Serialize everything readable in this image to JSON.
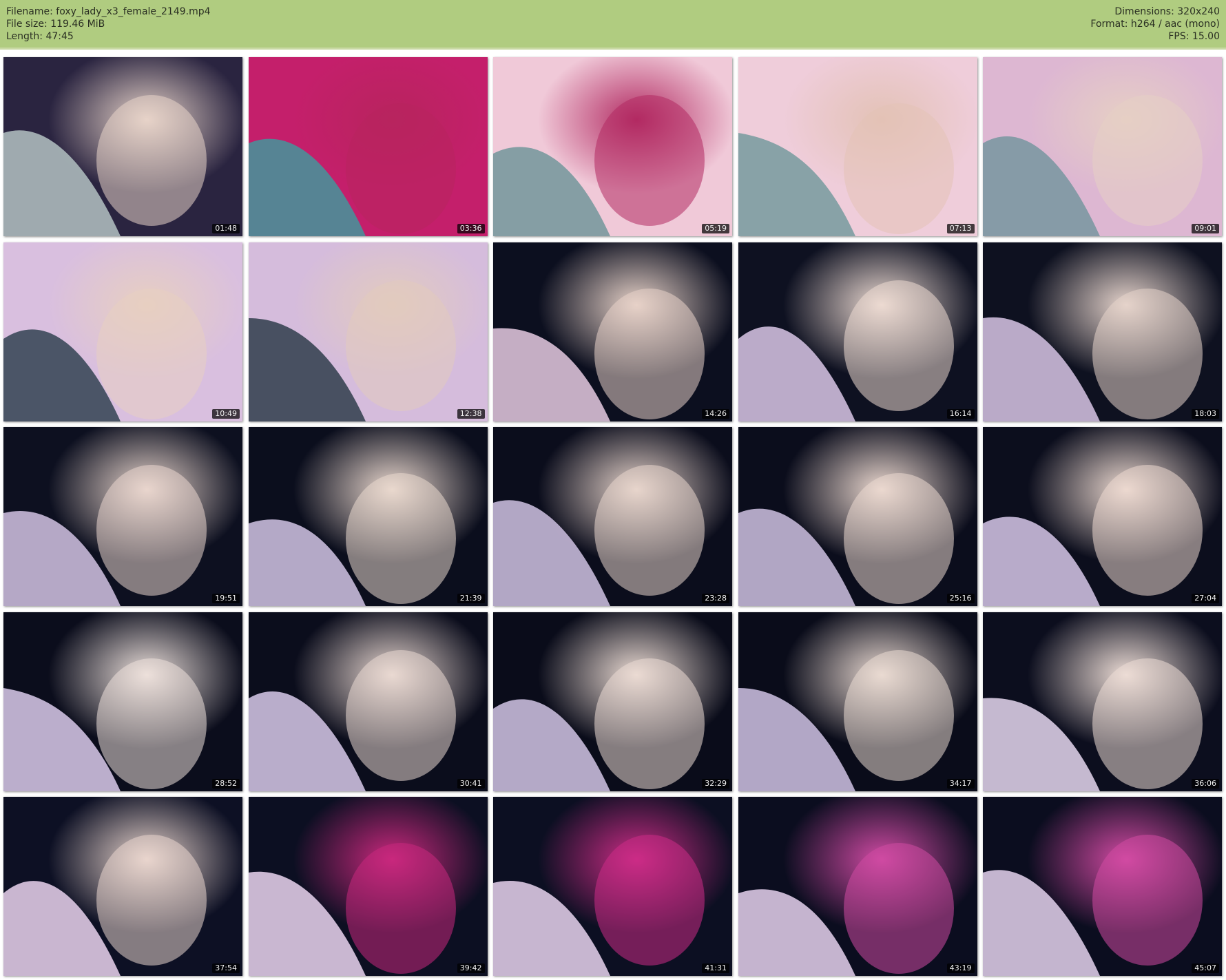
{
  "header": {
    "filename_label": "Filename: foxy_lady_x3_female_2149.mp4",
    "filesize_label": "File size: 119.46 MiB",
    "length_label": "Length: 47:45",
    "dimensions_label": "Dimensions: 320x240",
    "format_label": "Format: h264 / aac (mono)",
    "fps_label": "FPS: 15.00"
  },
  "colors": {
    "header_bg": "#b0cc80",
    "timestamp_bg": "#000000",
    "timestamp_text": "#f2f2f2"
  },
  "thumbnails": [
    {
      "time": "01:48",
      "palette": [
        "#2a2440",
        "#a9b6b9",
        "#e7d3c9"
      ]
    },
    {
      "time": "03:36",
      "palette": [
        "#c41f6b",
        "#4c8d98",
        "#b8245e"
      ]
    },
    {
      "time": "05:19",
      "palette": [
        "#f0c9d8",
        "#7c9aa0",
        "#b22a62"
      ]
    },
    {
      "time": "07:13",
      "palette": [
        "#efcdda",
        "#7f9ea3",
        "#e3c2b6"
      ]
    },
    {
      "time": "09:01",
      "palette": [
        "#ddb7d2",
        "#7e98a3",
        "#e6cfc4"
      ]
    },
    {
      "time": "10:49",
      "palette": [
        "#d9bfdf",
        "#3f4c5c",
        "#e7cfc1"
      ]
    },
    {
      "time": "12:38",
      "palette": [
        "#d5bcdc",
        "#3c4656",
        "#e2cbbe"
      ]
    },
    {
      "time": "14:26",
      "palette": [
        "#0c0f1f",
        "#d6bcd3",
        "#e7d2c8"
      ]
    },
    {
      "time": "16:14",
      "palette": [
        "#0e1121",
        "#cab9d8",
        "#ecdad2"
      ]
    },
    {
      "time": "18:03",
      "palette": [
        "#0e1120",
        "#c9b7d7",
        "#e5d3cb"
      ]
    },
    {
      "time": "19:51",
      "palette": [
        "#0d1020",
        "#c3b5d5",
        "#e9d6cd"
      ]
    },
    {
      "time": "21:39",
      "palette": [
        "#0b0e1d",
        "#c3b6d6",
        "#ead8ce"
      ]
    },
    {
      "time": "23:28",
      "palette": [
        "#0b0d1c",
        "#c1b4d4",
        "#e8d5cc"
      ]
    },
    {
      "time": "25:16",
      "palette": [
        "#0b0d1c",
        "#c0b3d3",
        "#ebd8cf"
      ]
    },
    {
      "time": "27:04",
      "palette": [
        "#0c0e1d",
        "#c8b9d9",
        "#ecd9d0"
      ]
    },
    {
      "time": "28:52",
      "palette": [
        "#0b0d1c",
        "#cbbcdb",
        "#ece0db"
      ]
    },
    {
      "time": "30:41",
      "palette": [
        "#0b0d1c",
        "#c9bbda",
        "#ead9d2"
      ]
    },
    {
      "time": "32:29",
      "palette": [
        "#0a0c1a",
        "#c3b7d6",
        "#ebdbd3"
      ]
    },
    {
      "time": "34:17",
      "palette": [
        "#0a0c1a",
        "#c1b5d5",
        "#eadad2"
      ]
    },
    {
      "time": "36:06",
      "palette": [
        "#0c0e1e",
        "#d6c8e0",
        "#ecdcd5"
      ]
    },
    {
      "time": "37:54",
      "palette": [
        "#0d1024",
        "#d9c4df",
        "#e9d5cd"
      ]
    },
    {
      "time": "39:42",
      "palette": [
        "#0c0f22",
        "#dac6e1",
        "#c9287d"
      ]
    },
    {
      "time": "41:31",
      "palette": [
        "#0c0f22",
        "#d8c4df",
        "#cc2c86"
      ]
    },
    {
      "time": "43:19",
      "palette": [
        "#0b0d1f",
        "#d6c2de",
        "#cf4aa3"
      ]
    },
    {
      "time": "45:07",
      "palette": [
        "#0b0d1f",
        "#d5c3de",
        "#d24aa3"
      ]
    }
  ]
}
